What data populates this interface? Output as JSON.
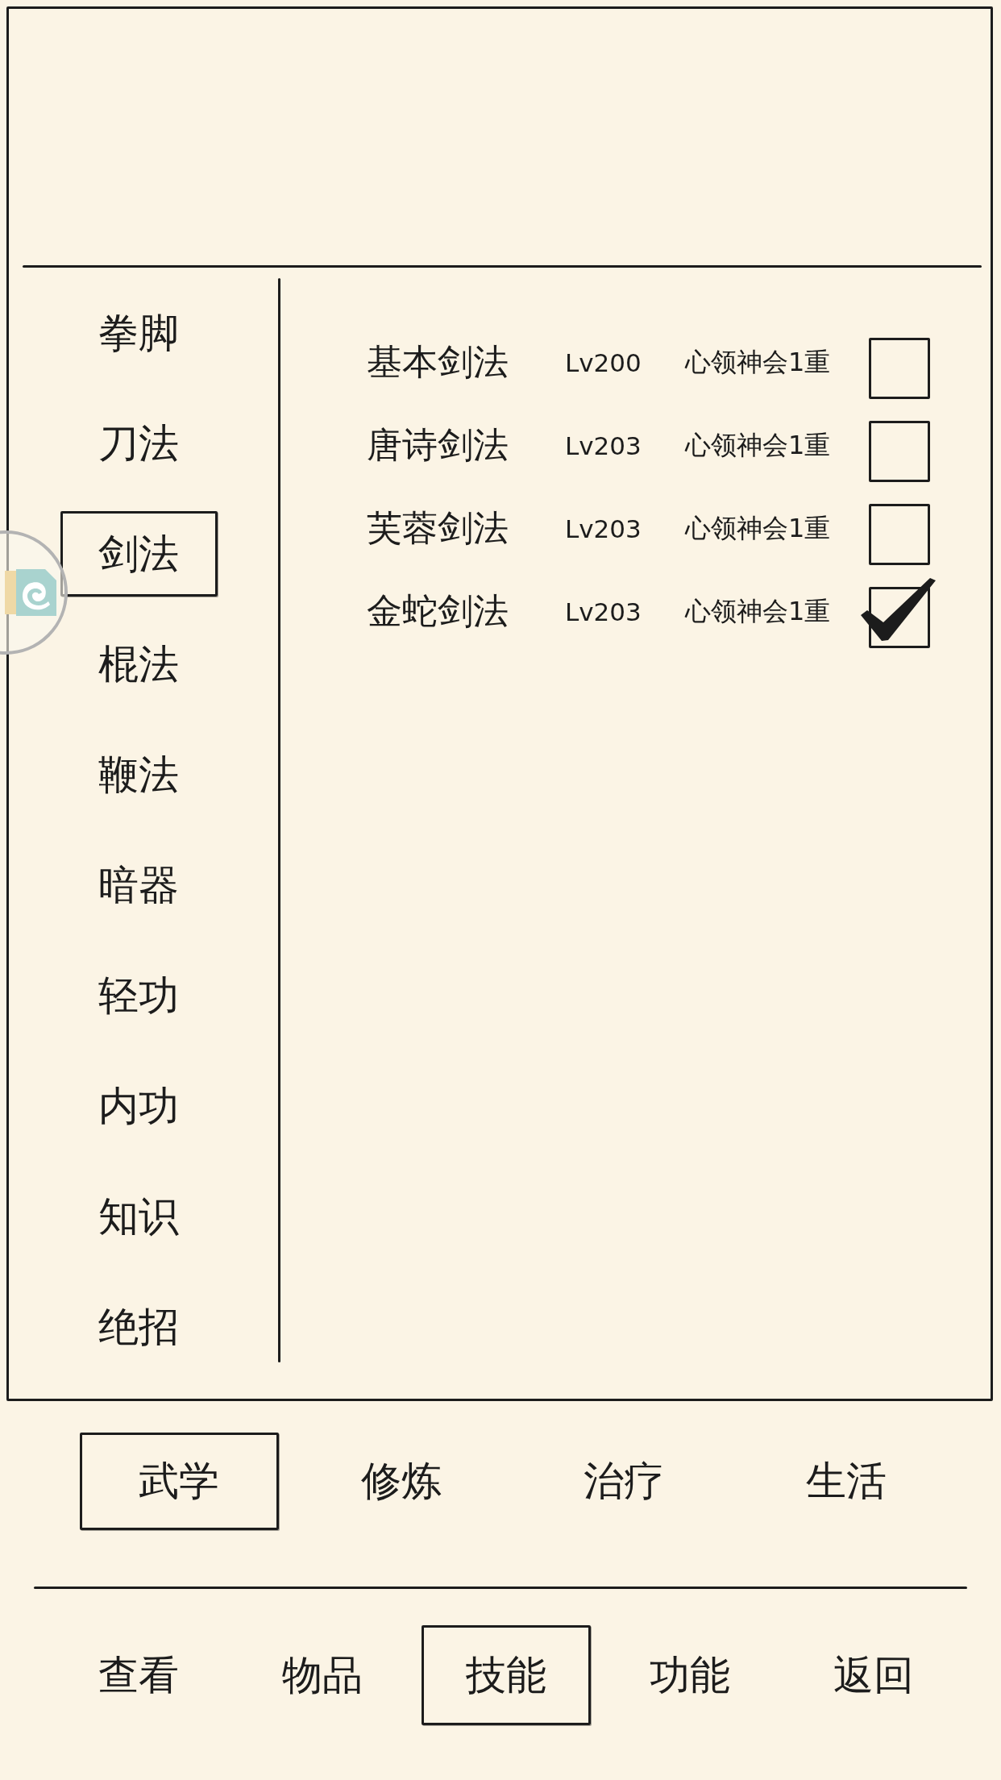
{
  "categories": [
    {
      "label": "拳脚",
      "selected": false
    },
    {
      "label": "刀法",
      "selected": false
    },
    {
      "label": "剑法",
      "selected": true
    },
    {
      "label": "棍法",
      "selected": false
    },
    {
      "label": "鞭法",
      "selected": false
    },
    {
      "label": "暗器",
      "selected": false
    },
    {
      "label": "轻功",
      "selected": false
    },
    {
      "label": "内功",
      "selected": false
    },
    {
      "label": "知识",
      "selected": false
    },
    {
      "label": "绝招",
      "selected": false
    }
  ],
  "skills": [
    {
      "name": "基本剑法",
      "level": "Lv200",
      "mastery": "心领神会1重",
      "checked": false
    },
    {
      "name": "唐诗剑法",
      "level": "Lv203",
      "mastery": "心领神会1重",
      "checked": false
    },
    {
      "name": "芙蓉剑法",
      "level": "Lv203",
      "mastery": "心领神会1重",
      "checked": false
    },
    {
      "name": "金蛇剑法",
      "level": "Lv203",
      "mastery": "心领神会1重",
      "checked": true
    }
  ],
  "sub_tabs": [
    {
      "label": "武学",
      "selected": true
    },
    {
      "label": "修炼",
      "selected": false
    },
    {
      "label": "治疗",
      "selected": false
    },
    {
      "label": "生活",
      "selected": false
    }
  ],
  "bottom_nav": [
    {
      "label": "查看",
      "selected": false
    },
    {
      "label": "物品",
      "selected": false
    },
    {
      "label": "技能",
      "selected": true
    },
    {
      "label": "功能",
      "selected": false
    },
    {
      "label": "返回",
      "selected": false
    }
  ]
}
